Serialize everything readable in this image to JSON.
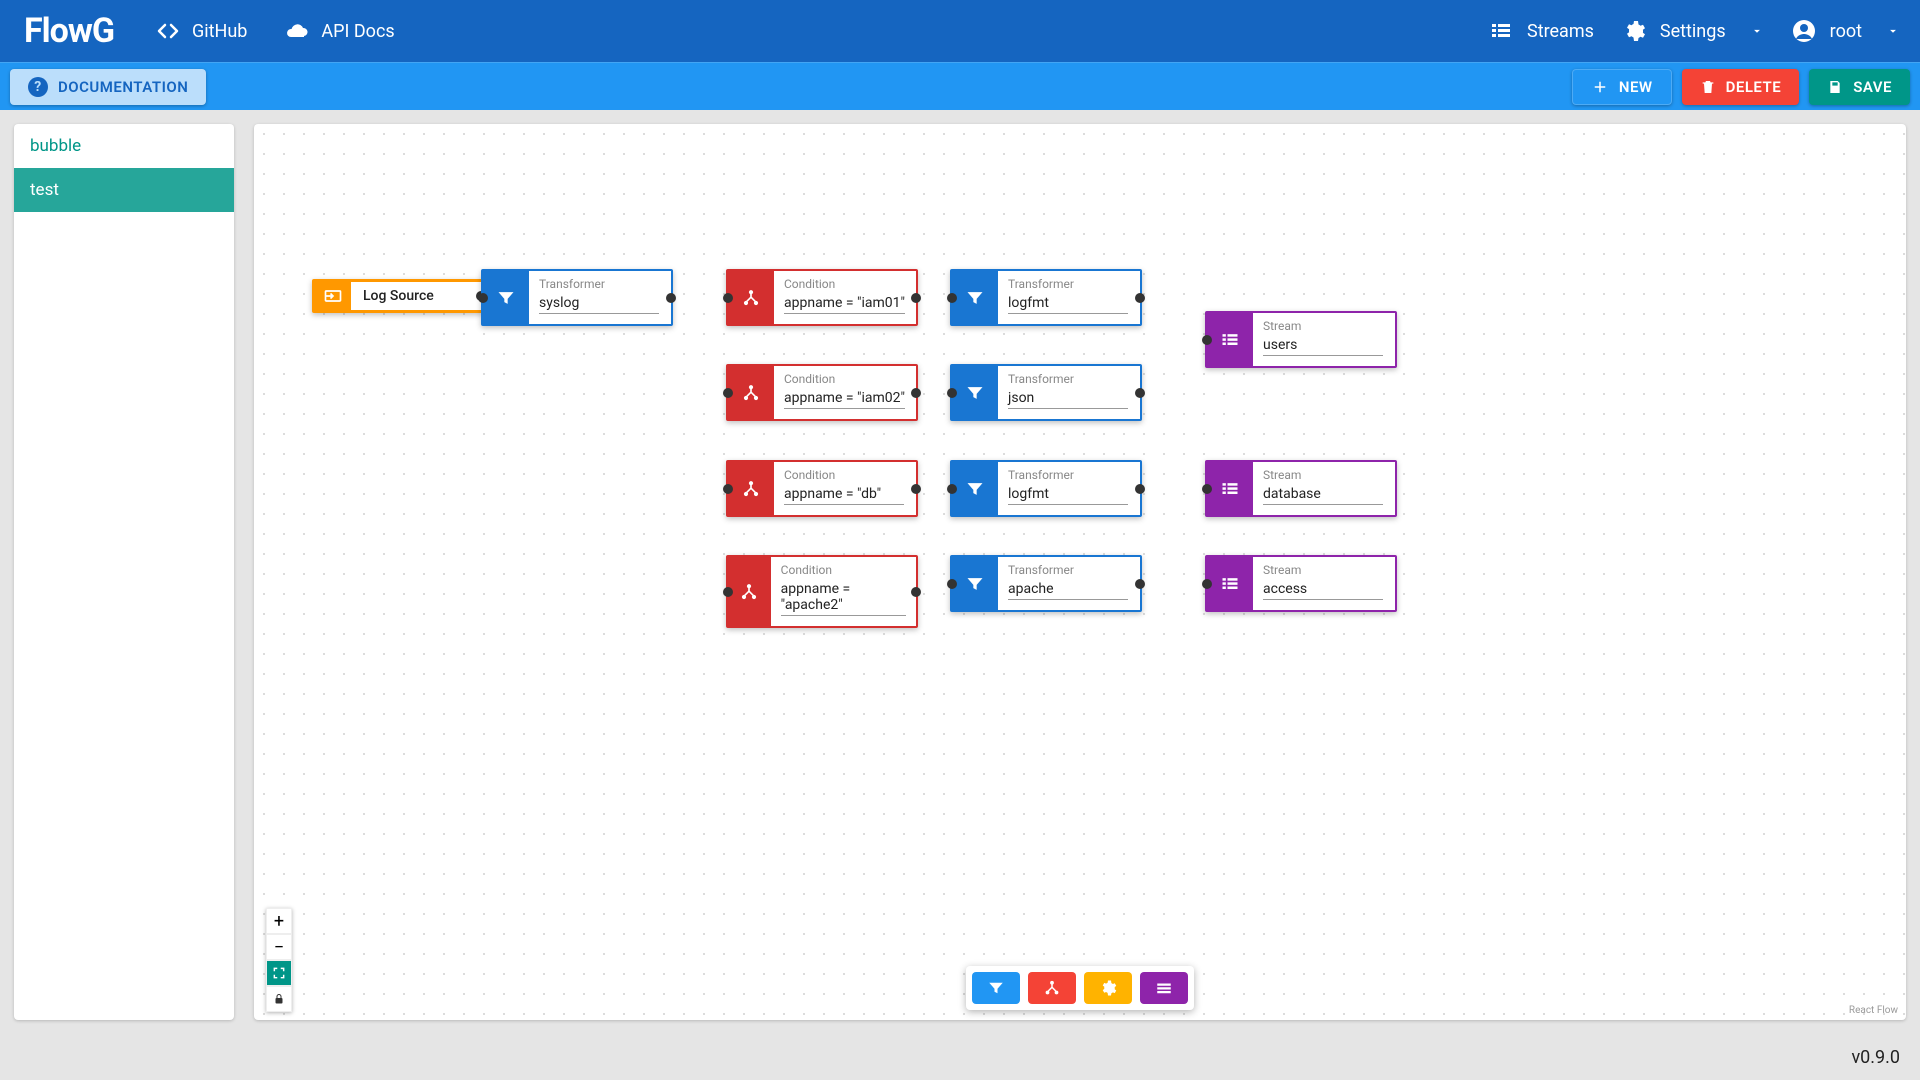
{
  "app": {
    "name": "FlowG"
  },
  "navbar": {
    "github": "GitHub",
    "apidocs": "API Docs",
    "streams": "Streams",
    "settings": "Settings",
    "user": "root"
  },
  "toolbar": {
    "documentation": "DOCUMENTATION",
    "new": "NEW",
    "delete": "DELETE",
    "save": "SAVE"
  },
  "sidebar": {
    "items": [
      "bubble",
      "test"
    ],
    "active_index": 1
  },
  "nodes": {
    "source": {
      "label": "Log Source"
    },
    "t_syslog": {
      "label": "Transformer",
      "value": "syslog"
    },
    "c_iam01": {
      "label": "Condition",
      "value": "appname  = \"iam01\""
    },
    "c_iam02": {
      "label": "Condition",
      "value": "appname = \"iam02\""
    },
    "c_db": {
      "label": "Condition",
      "value": "appname = \"db\""
    },
    "c_apache": {
      "label": "Condition",
      "value": "appname = \"apache2\""
    },
    "t_logfmt1": {
      "label": "Transformer",
      "value": "logfmt"
    },
    "t_json": {
      "label": "Transformer",
      "value": "json"
    },
    "t_logfmt2": {
      "label": "Transformer",
      "value": "logfmt"
    },
    "t_apache": {
      "label": "Transformer",
      "value": "apache"
    },
    "s_users": {
      "label": "Stream",
      "value": "users"
    },
    "s_database": {
      "label": "Stream",
      "value": "database"
    },
    "s_access": {
      "label": "Stream",
      "value": "access"
    }
  },
  "canvas": {
    "attribution": "React Flow"
  },
  "footer": {
    "version": "v0.9.0"
  }
}
